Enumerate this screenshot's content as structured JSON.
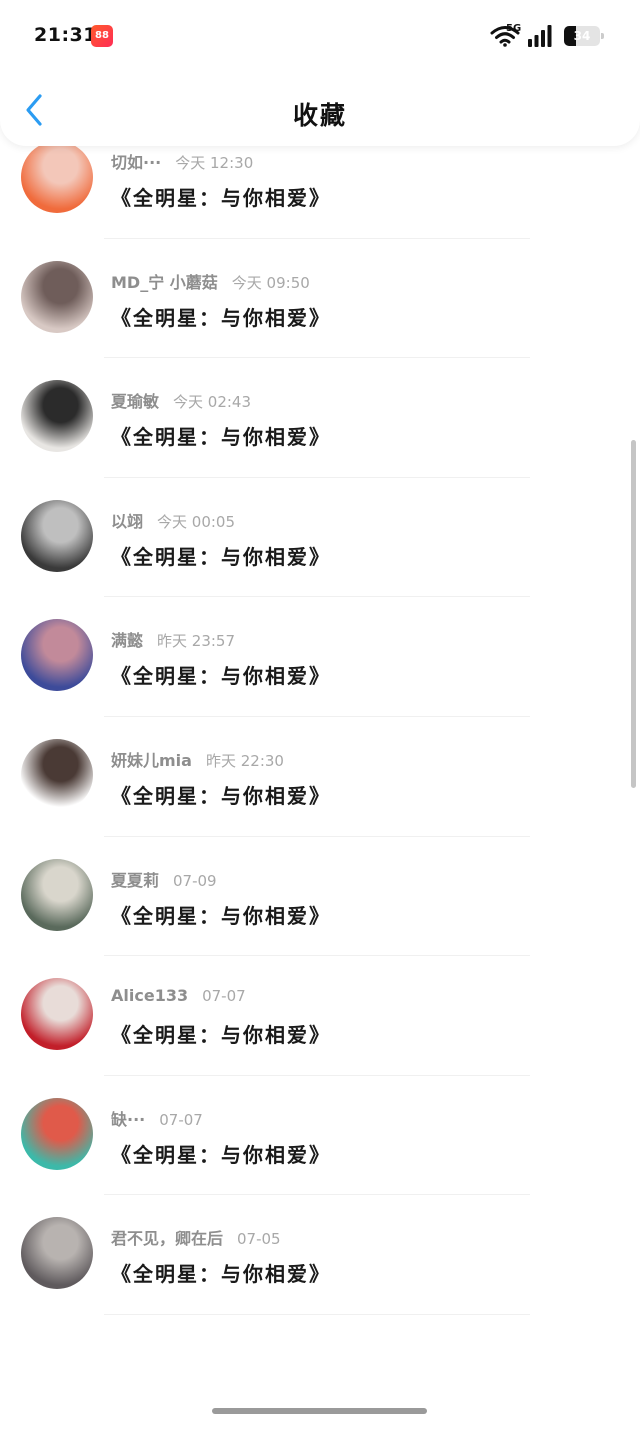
{
  "status_bar": {
    "time": "21:31",
    "app_badge": "88",
    "network": "5G",
    "battery": "34",
    "battery_fraction": 0.34
  },
  "nav": {
    "title": "收藏",
    "back_icon": "chevron-left-icon",
    "accent_color": "#2b9cf2"
  },
  "items": [
    {
      "user": "",
      "time": "",
      "content": "《全明星：与你相爱》",
      "avatar_colors": [
        "#6b8a7b",
        "#c9d3c8"
      ]
    },
    {
      "user": "切如···",
      "time": "今天 12:30",
      "content": "《全明星：与你相爱》",
      "avatar_colors": [
        "#f06b3c",
        "#f3c7b9"
      ]
    },
    {
      "user": "MD_宁 小蘑菇",
      "time": "今天 09:50",
      "content": "《全明星：与你相爱》",
      "avatar_colors": [
        "#d8c9c4",
        "#6f5d5a"
      ]
    },
    {
      "user": "夏瑜敏",
      "time": "今天 02:43",
      "content": "《全明星：与你相爱》",
      "avatar_colors": [
        "#e8e6e3",
        "#2b2b2b"
      ]
    },
    {
      "user": "以翊",
      "time": "今天 00:05",
      "content": "《全明星：与你相爱》",
      "avatar_colors": [
        "#3a3a3a",
        "#bfbfbf"
      ]
    },
    {
      "user": "满懿",
      "time": "昨天 23:57",
      "content": "《全明星：与你相爱》",
      "avatar_colors": [
        "#3d4b9a",
        "#c28a9a"
      ]
    },
    {
      "user": "妍妹儿mia",
      "time": "昨天 22:30",
      "content": "《全明星：与你相爱》",
      "avatar_colors": [
        "#ffffff",
        "#4a3a35"
      ]
    },
    {
      "user": "夏夏莉",
      "time": "07-09",
      "content": "《全明星：与你相爱》",
      "avatar_colors": [
        "#5a6a5c",
        "#d9d6cc"
      ]
    },
    {
      "user": "Alice133",
      "time": "07-07",
      "content": "《全明星：与你相爱》",
      "avatar_colors": [
        "#c21f2a",
        "#e8dcd8"
      ]
    },
    {
      "user": "缺···",
      "time": "07-07",
      "content": "《全明星：与你相爱》",
      "avatar_colors": [
        "#3cb9a9",
        "#e05a4a"
      ]
    },
    {
      "user": "君不见，卿在后",
      "time": "07-05",
      "content": "《全明星：与你相爱》",
      "avatar_colors": [
        "#5f5a5d",
        "#b8b3b0"
      ]
    }
  ]
}
